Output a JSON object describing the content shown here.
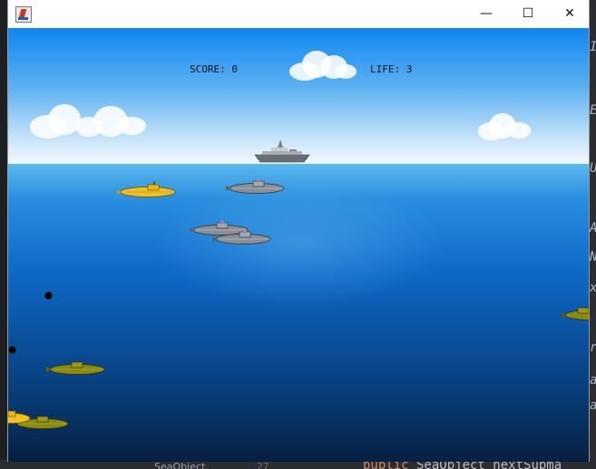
{
  "window": {
    "title": "",
    "buttons": {
      "minimize": "—",
      "maximize": "☐",
      "close": "✕"
    }
  },
  "hud": {
    "score_label": "SCORE:",
    "score_value": "0",
    "life_label": "LIFE:",
    "life_value": "3"
  },
  "ide": {
    "tab_label": "SeaObject",
    "line_number": "27",
    "code_keyword": "public",
    "code_rest": " SeaObject nextSubma"
  },
  "colors": {
    "sky_top": "#0e86f0",
    "sea_deep": "#051f40",
    "yellow_sub": "#f0c020",
    "gray_sub": "#8a8f96",
    "olive_sub": "#8a8a10"
  },
  "icons": [
    "java-app-icon",
    "minimize-icon",
    "maximize-icon",
    "close-icon"
  ]
}
